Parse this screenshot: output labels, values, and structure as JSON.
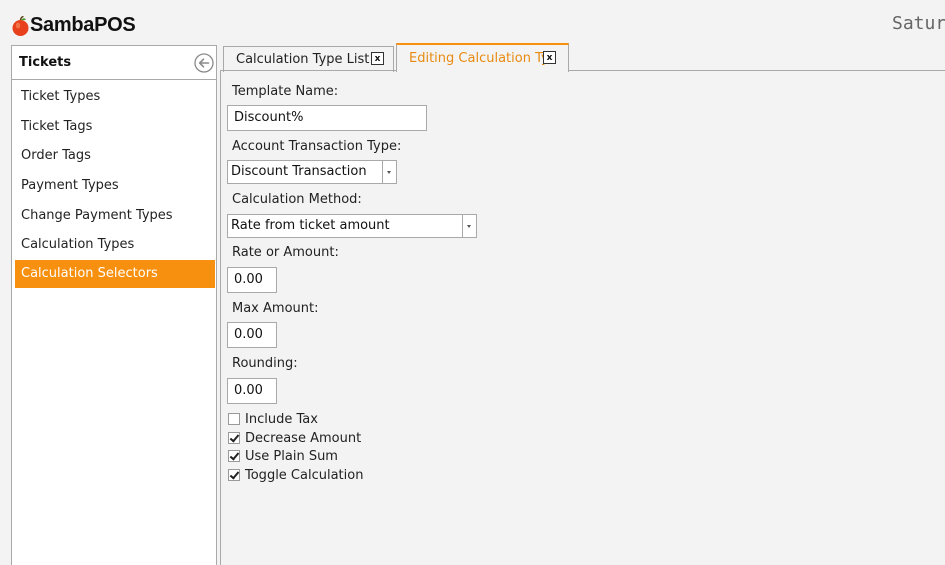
{
  "app": {
    "logo_text": "SambaPOS",
    "clock_text": "Satur"
  },
  "sidebar": {
    "title": "Tickets",
    "back_icon": "circle-arrow-left-icon",
    "items": [
      {
        "label": "Ticket Types"
      },
      {
        "label": "Ticket Tags"
      },
      {
        "label": "Order Tags"
      },
      {
        "label": "Payment Types"
      },
      {
        "label": "Change Payment Types"
      },
      {
        "label": "Calculation Types"
      },
      {
        "label": "Calculation Selectors"
      }
    ],
    "active_item": "Calculation Selectors"
  },
  "tabs": [
    {
      "label": "Calculation Type List",
      "close": "x"
    },
    {
      "label": "Editing Calculation Ty",
      "close": "x"
    }
  ],
  "form": {
    "template_name_label": "Template Name:",
    "template_name_value": "Discount%",
    "account_tx_type_label": "Account Transaction Type:",
    "account_tx_type_value": "Discount Transaction",
    "calc_method_label": "Calculation Method:",
    "calc_method_value": "Rate from ticket amount",
    "rate_label": "Rate or Amount:",
    "rate_value": "0.00",
    "max_label": "Max Amount:",
    "max_value": "0.00",
    "rounding_label": "Rounding:",
    "rounding_value": "0.00",
    "checkboxes": [
      {
        "label": "Include Tax",
        "checked": false
      },
      {
        "label": "Decrease Amount",
        "checked": true
      },
      {
        "label": "Use Plain Sum",
        "checked": true
      },
      {
        "label": "Toggle Calculation",
        "checked": true
      }
    ]
  },
  "colors": {
    "accent": "#f7900f",
    "logo_red": "#e8401c"
  }
}
